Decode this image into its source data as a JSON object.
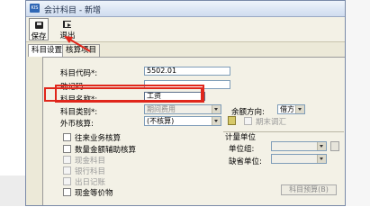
{
  "window": {
    "icon_text": "KIS",
    "title": "会计科目 - 新增"
  },
  "toolbar": {
    "save_label": "保存",
    "exit_label": "退出"
  },
  "tabs": [
    {
      "label": "科目设置"
    },
    {
      "label": "核算项目"
    }
  ],
  "form": {
    "code_label": "科目代码*:",
    "code_value": "5502.01",
    "mnemonic_label": "助记码:",
    "mnemonic_value": "",
    "name_label": "科目名称*:",
    "name_value": "工资",
    "category_label": "科目类别*:",
    "category_value": "期间费用",
    "balance_direction_label": "余额方向:",
    "balance_direction_value": "借方",
    "currency_label": "外币核算:",
    "currency_value": "(不核算)",
    "period_end_fx_label": "期末调汇"
  },
  "checkboxes": [
    {
      "label": "往来业务核算",
      "enabled": true
    },
    {
      "label": "数量金额辅助核算",
      "enabled": true
    },
    {
      "label": "现金科目",
      "enabled": false
    },
    {
      "label": "银行科目",
      "enabled": false
    },
    {
      "label": "出日记账",
      "enabled": false
    },
    {
      "label": "现金等价物",
      "enabled": true
    }
  ],
  "unit_group": {
    "title": "计量单位",
    "unit_group_label": "单位组:",
    "unit_group_value": "",
    "default_unit_label": "缺省单位:",
    "default_unit_value": ""
  },
  "budget_button": "科目预算(B)",
  "colors": {
    "annotation_red": "#e0261b",
    "dialog_bg": "#ece9d8"
  }
}
